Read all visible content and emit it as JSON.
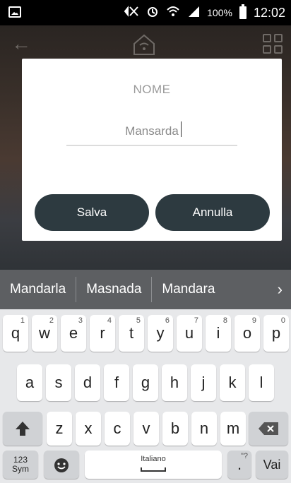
{
  "status_bar": {
    "battery_percent": "100%",
    "time": "12:02",
    "icons": [
      "gallery-icon",
      "mute-icon",
      "alarm-icon",
      "wifi-icon",
      "signal-icon",
      "battery-icon"
    ]
  },
  "topbar": {
    "back_icon": "back-arrow-icon",
    "center_icon": "home-wifi-icon",
    "right_icon": "grid-icon"
  },
  "dialog": {
    "title": "NOME",
    "field_value": "Mansarda",
    "save_label": "Salva",
    "cancel_label": "Annulla"
  },
  "keyboard": {
    "suggestions": [
      "Mandarla",
      "Masnada",
      "Mandara"
    ],
    "row1": [
      {
        "k": "q",
        "s": "1"
      },
      {
        "k": "w",
        "s": "2"
      },
      {
        "k": "e",
        "s": "3"
      },
      {
        "k": "r",
        "s": "4"
      },
      {
        "k": "t",
        "s": "5"
      },
      {
        "k": "y",
        "s": "6"
      },
      {
        "k": "u",
        "s": "7"
      },
      {
        "k": "i",
        "s": "8"
      },
      {
        "k": "o",
        "s": "9"
      },
      {
        "k": "p",
        "s": "0"
      }
    ],
    "row2": [
      "a",
      "s",
      "d",
      "f",
      "g",
      "h",
      "j",
      "k",
      "l"
    ],
    "row3": [
      "z",
      "x",
      "c",
      "v",
      "b",
      "n",
      "m"
    ],
    "sym_label_1": "123",
    "sym_label_2": "Sym",
    "space_label": "Italiano",
    "period": ".",
    "period_sup": "\"?",
    "go_label": "Vai"
  }
}
